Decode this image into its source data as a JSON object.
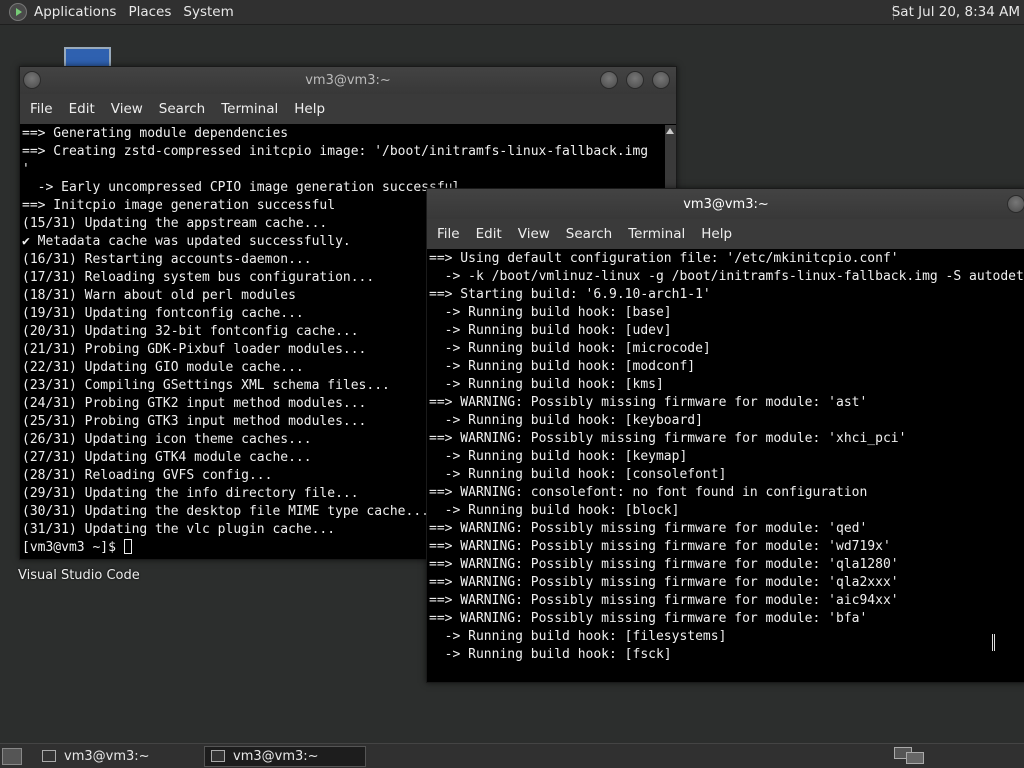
{
  "top_panel": {
    "menus": [
      "Applications",
      "Places",
      "System"
    ],
    "clock": "Sat Jul 20,  8:34 AM"
  },
  "desktop": {
    "icon_label": "Visual Studio Code"
  },
  "window_back": {
    "title": "vm3@vm3:~",
    "menu": [
      "File",
      "Edit",
      "View",
      "Search",
      "Terminal",
      "Help"
    ],
    "lines": [
      "==> Generating module dependencies",
      "==> Creating zstd-compressed initcpio image: '/boot/initramfs-linux-fallback.img",
      "'",
      "  -> Early uncompressed CPIO image generation successful",
      "==> Initcpio image generation successful",
      "(15/31) Updating the appstream cache...",
      "✔ Metadata cache was updated successfully.",
      "(16/31) Restarting accounts-daemon...",
      "(17/31) Reloading system bus configuration...",
      "(18/31) Warn about old perl modules",
      "(19/31) Updating fontconfig cache...",
      "(20/31) Updating 32-bit fontconfig cache...",
      "(21/31) Probing GDK-Pixbuf loader modules...",
      "(22/31) Updating GIO module cache...",
      "(23/31) Compiling GSettings XML schema files...",
      "(24/31) Probing GTK2 input method modules...",
      "(25/31) Probing GTK3 input method modules...",
      "(26/31) Updating icon theme caches...",
      "(27/31) Updating GTK4 module cache...",
      "(28/31) Reloading GVFS config...",
      "(29/31) Updating the info directory file...",
      "(30/31) Updating the desktop file MIME type cache...",
      "(31/31) Updating the vlc plugin cache..."
    ],
    "prompt": "[vm3@vm3 ~]$ "
  },
  "window_front": {
    "title": "vm3@vm3:~",
    "menu": [
      "File",
      "Edit",
      "View",
      "Search",
      "Terminal",
      "Help"
    ],
    "lines": [
      "==> Using default configuration file: '/etc/mkinitcpio.conf'",
      "  -> -k /boot/vmlinuz-linux -g /boot/initramfs-linux-fallback.img -S autodetect",
      "==> Starting build: '6.9.10-arch1-1'",
      "  -> Running build hook: [base]",
      "  -> Running build hook: [udev]",
      "  -> Running build hook: [microcode]",
      "  -> Running build hook: [modconf]",
      "  -> Running build hook: [kms]",
      "==> WARNING: Possibly missing firmware for module: 'ast'",
      "  -> Running build hook: [keyboard]",
      "==> WARNING: Possibly missing firmware for module: 'xhci_pci'",
      "  -> Running build hook: [keymap]",
      "  -> Running build hook: [consolefont]",
      "==> WARNING: consolefont: no font found in configuration",
      "  -> Running build hook: [block]",
      "==> WARNING: Possibly missing firmware for module: 'qed'",
      "==> WARNING: Possibly missing firmware for module: 'wd719x'",
      "==> WARNING: Possibly missing firmware for module: 'qla1280'",
      "==> WARNING: Possibly missing firmware for module: 'qla2xxx'",
      "==> WARNING: Possibly missing firmware for module: 'aic94xx'",
      "==> WARNING: Possibly missing firmware for module: 'bfa'",
      "  -> Running build hook: [filesystems]",
      "  -> Running build hook: [fsck]"
    ]
  },
  "taskbar": {
    "tasks": [
      "vm3@vm3:~",
      "vm3@vm3:~"
    ]
  },
  "icons": {
    "menu_logo": "distro-logo-icon",
    "show_desktop": "show-desktop-icon",
    "workspace": "workspace-switcher-icon",
    "task_icon": "terminal-icon",
    "text_cursor": "ibeam-cursor-icon"
  }
}
